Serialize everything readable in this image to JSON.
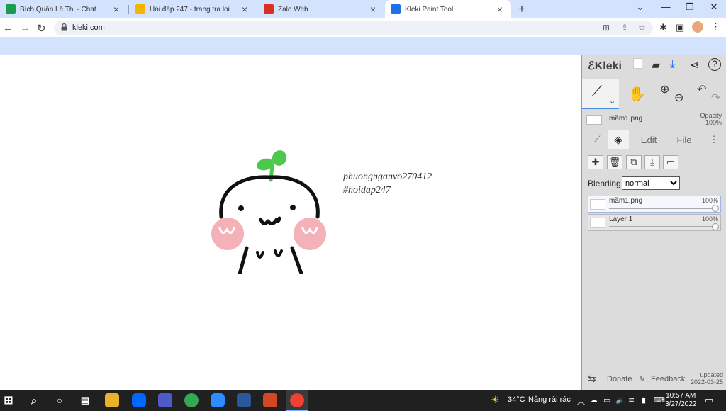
{
  "browser": {
    "tabs": [
      {
        "title": "Bích Quân Lê Thị - Chat",
        "favicon_color": "#1a9d4c"
      },
      {
        "title": "Hỏi đáp 247 - trang tra loi",
        "favicon_color": "#f4b400"
      },
      {
        "title": "Zalo Web",
        "favicon_color": "#d93025"
      },
      {
        "title": "Kleki Paint Tool",
        "favicon_color": "#1a73e8"
      }
    ],
    "active_tab_index": 3,
    "url": "kleki.com"
  },
  "canvas": {
    "caption_line1": "phuongnganvo270412",
    "caption_line2": "#hoidap247",
    "sprout_color": "#4cc94c",
    "cheek_color": "#f4a9b0"
  },
  "kleki": {
    "logo": "Kleki",
    "current_layer": "mầm1.png",
    "opacity_label": "Opacity",
    "opacity_value": "100%",
    "tabs": {
      "edit": "Edit",
      "file": "File"
    },
    "blending_label": "Blending",
    "blending_value": "normal",
    "layers": [
      {
        "name": "mầm1.png",
        "opacity": "100%",
        "selected": true
      },
      {
        "name": "Layer 1",
        "opacity": "100%",
        "selected": false
      }
    ],
    "footer": {
      "donate": "Donate",
      "feedback": "Feedback",
      "updated_label": "updated",
      "updated_date": "2022-03-25"
    }
  },
  "taskbar": {
    "weather_temp": "34°C",
    "weather_text": "Nắng rải rác",
    "time": "10:57 AM",
    "date": "3/27/2022"
  },
  "colors": {
    "chrome_band": "#d3e3fd",
    "accent": "#1a73e8",
    "taskbar": "#202020"
  }
}
